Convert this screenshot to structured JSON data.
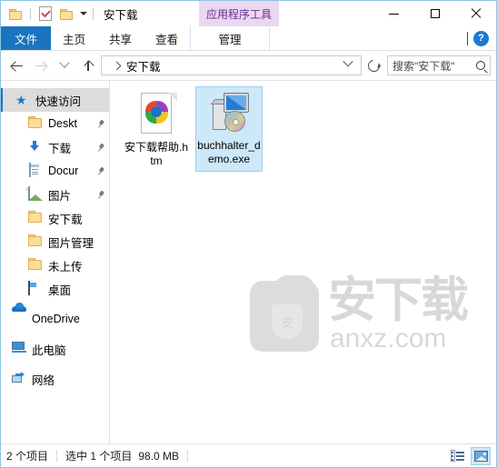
{
  "window": {
    "title": "安下载",
    "contextual_tab_group": "应用程序工具",
    "quick_access": [
      {
        "name": "folder-icon",
        "label": "文件夹"
      },
      {
        "name": "properties-icon",
        "label": "属性"
      },
      {
        "name": "new-folder-icon",
        "label": "新建文件夹"
      },
      {
        "name": "customize-dropdown",
        "label": "自定义快速访问工具栏"
      }
    ],
    "controls": {
      "minimize": "最小化",
      "maximize": "最大化",
      "close": "关闭"
    }
  },
  "ribbon": {
    "tabs": [
      {
        "label": "文件",
        "active": true
      },
      {
        "label": "主页",
        "active": false
      },
      {
        "label": "共享",
        "active": false
      },
      {
        "label": "查看",
        "active": false
      }
    ],
    "contextual_tab": "管理",
    "collapse_label": "展开功能区",
    "help_label": "?"
  },
  "address": {
    "back": "后退",
    "forward": "前进",
    "recent": "最近浏览的位置",
    "up": "上移到",
    "breadcrumb": "安下载",
    "dropdown": "历史记录",
    "refresh": "刷新",
    "search_placeholder": "搜索\"安下载\""
  },
  "sidebar": {
    "items": [
      {
        "label": "快速访问",
        "icon": "star-icon",
        "selected": true,
        "indent": false,
        "pinned": false
      },
      {
        "label": "Deskt",
        "icon": "folder-icon",
        "selected": false,
        "indent": true,
        "pinned": true
      },
      {
        "label": "下载",
        "icon": "download-icon",
        "selected": false,
        "indent": true,
        "pinned": true
      },
      {
        "label": "Docur",
        "icon": "document-icon",
        "selected": false,
        "indent": true,
        "pinned": true
      },
      {
        "label": "图片",
        "icon": "pictures-icon",
        "selected": false,
        "indent": true,
        "pinned": true
      },
      {
        "label": "安下载",
        "icon": "folder-icon",
        "selected": false,
        "indent": true,
        "pinned": false
      },
      {
        "label": "图片管理",
        "icon": "folder-icon",
        "selected": false,
        "indent": true,
        "pinned": false
      },
      {
        "label": "未上传",
        "icon": "folder-icon",
        "selected": false,
        "indent": true,
        "pinned": false
      },
      {
        "label": "桌面",
        "icon": "desktop-icon",
        "selected": false,
        "indent": true,
        "pinned": false
      },
      {
        "label": "OneDrive",
        "icon": "cloud-icon",
        "selected": false,
        "indent": false,
        "pinned": false
      },
      {
        "label": "此电脑",
        "icon": "this-pc-icon",
        "selected": false,
        "indent": false,
        "pinned": false
      },
      {
        "label": "网络",
        "icon": "network-icon",
        "selected": false,
        "indent": false,
        "pinned": false
      }
    ]
  },
  "files": [
    {
      "name": "安下载帮助.htm",
      "icon": "html-file-icon",
      "selected": false
    },
    {
      "name": "buchhalter_demo.exe",
      "icon": "executable-icon",
      "selected": true
    }
  ],
  "watermark": {
    "text_cn": "安下载",
    "url": "anxz.com",
    "shield_char": "安"
  },
  "status": {
    "item_count": "2 个项目",
    "selection": "选中 1 个项目",
    "size": "98.0 MB",
    "view_details": "详细信息",
    "view_large_icons": "大图标"
  },
  "colors": {
    "accent_blue": "#1a74c0",
    "contextual_purple_bg": "#ead7f1",
    "contextual_purple_text": "#6b2d8e",
    "selection_blue": "#cce8f9",
    "selection_border": "#99d1f2",
    "window_border": "#8ec6e6",
    "watermark_gray": "#d8d8d8"
  }
}
